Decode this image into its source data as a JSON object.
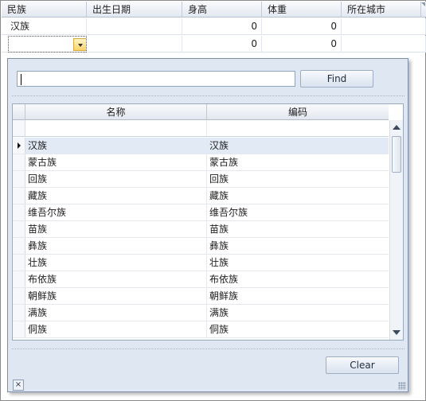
{
  "grid": {
    "columns": [
      "民族",
      "出生日期",
      "身高",
      "体重",
      "所在城市"
    ],
    "rows": [
      {
        "ethnic": "汉族",
        "birthdate": "",
        "height": "0",
        "weight": "0",
        "city": ""
      },
      {
        "ethnic": "",
        "birthdate": "",
        "height": "0",
        "weight": "0",
        "city": ""
      }
    ]
  },
  "popup": {
    "search_value": "",
    "find_label": "Find",
    "clear_label": "Clear",
    "close_glyph": "×",
    "columns": [
      "名称",
      "编码"
    ],
    "items": [
      {
        "name": "汉族",
        "code": "汉族"
      },
      {
        "name": "蒙古族",
        "code": "蒙古族"
      },
      {
        "name": "回族",
        "code": "回族"
      },
      {
        "name": "藏族",
        "code": "藏族"
      },
      {
        "name": "维吾尔族",
        "code": "维吾尔族"
      },
      {
        "name": "苗族",
        "code": "苗族"
      },
      {
        "name": "彝族",
        "code": "彝族"
      },
      {
        "name": "壮族",
        "code": "壮族"
      },
      {
        "name": "布依族",
        "code": "布依族"
      },
      {
        "name": "朝鲜族",
        "code": "朝鲜族"
      },
      {
        "name": "满族",
        "code": "满族"
      },
      {
        "name": "侗族",
        "code": "侗族"
      }
    ],
    "focused_index": 0
  },
  "icons": {
    "dropdown": "chevron-down-icon",
    "row_indicator": "row-indicator-icon",
    "scroll_up": "scroll-up-icon",
    "scroll_down": "scroll-down-icon",
    "close": "close-icon",
    "resize": "resize-grip-icon"
  },
  "colors": {
    "header_bg": "#e3e8f0",
    "popup_bg": "#dfe7f2",
    "focused_row": "#e2eaf5",
    "dropdown_button": "#fbd56b"
  }
}
